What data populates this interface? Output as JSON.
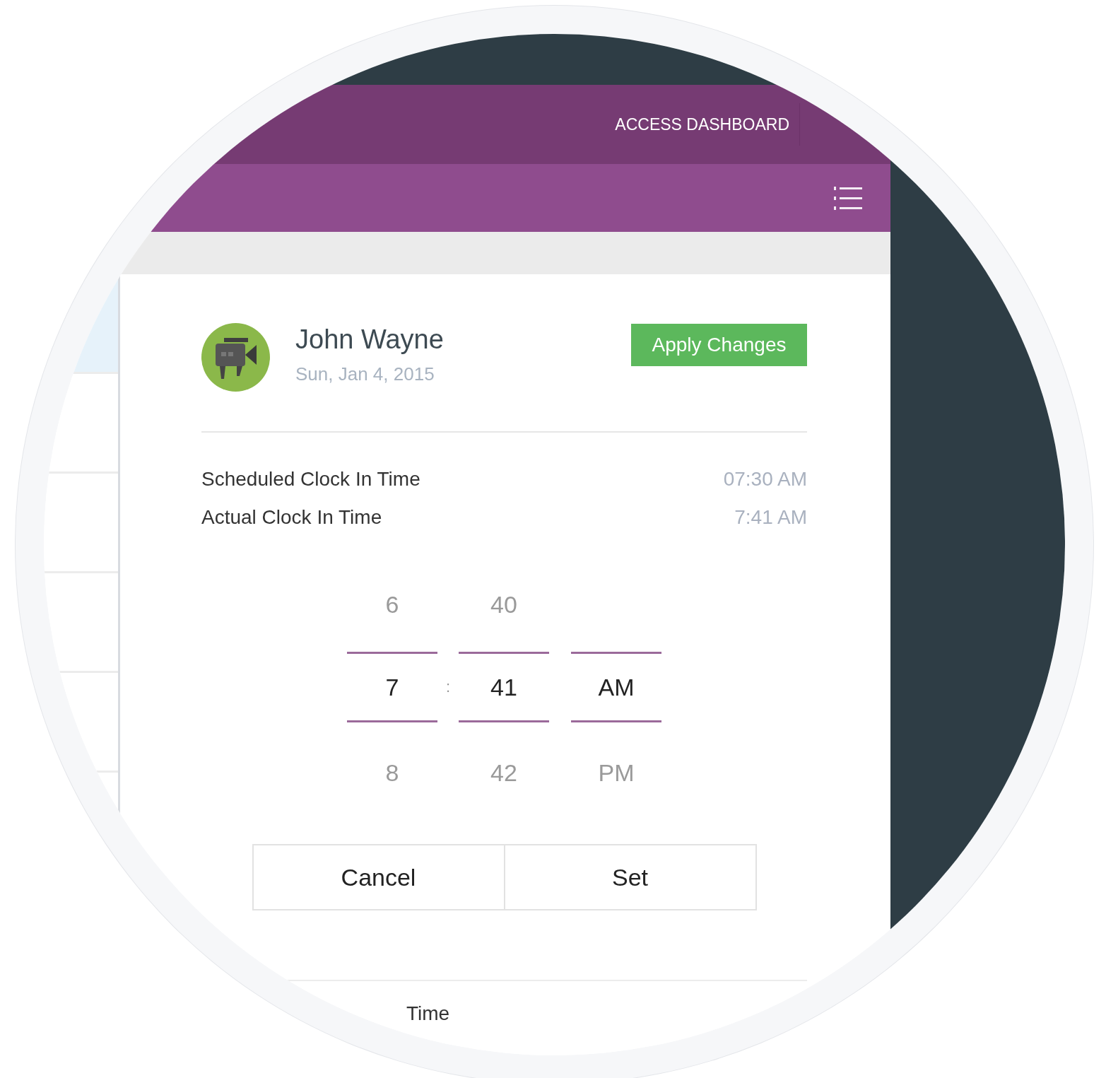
{
  "header": {
    "link": "ACCESS DASHBOARD"
  },
  "side_list": {
    "rows": [
      {
        "selected": true
      },
      {
        "selected": false
      },
      {
        "selected": false
      },
      {
        "selected": false
      },
      {
        "selected": false
      }
    ]
  },
  "employee": {
    "name": "John Wayne",
    "date": "Sun, Jan 4, 2015"
  },
  "apply_button": "Apply Changes",
  "times": [
    {
      "label": "Scheduled Clock In Time",
      "value": "07:30 AM"
    },
    {
      "label": "Actual Clock In Time",
      "value": "7:41 AM"
    }
  ],
  "picker": {
    "separator": ":",
    "columns": [
      {
        "above": "6",
        "value": "7",
        "below": "8"
      },
      {
        "above": "40",
        "value": "41",
        "below": "42"
      },
      {
        "value": "AM",
        "below": "PM"
      }
    ]
  },
  "buttons": [
    "Cancel",
    "Set"
  ],
  "next_section": {
    "label": "Time"
  }
}
